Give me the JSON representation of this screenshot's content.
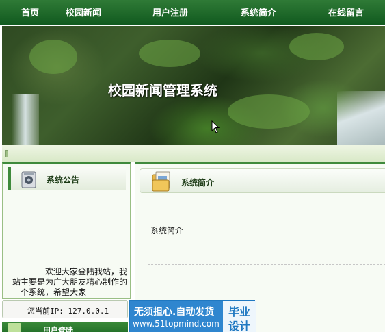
{
  "nav": {
    "items": [
      "首页",
      "校园新闻",
      "用户注册",
      "系统简介",
      "在线留言"
    ]
  },
  "banner": {
    "title": "校园新闻管理系统"
  },
  "sidebar": {
    "notice_title": "系统公告",
    "notice_text": "欢迎大家登陆我站，我站主要是为广大朋友精心制作的一个系统，希望大家"
  },
  "ip": {
    "text": "您当前IP: 127.0.0.1"
  },
  "login": {
    "title": "用户登陆"
  },
  "main": {
    "section_title": "系统简介",
    "body_text": "系统简介"
  },
  "watermark": {
    "line1": "无须担心.自动发货",
    "line2": "www.51topmind.com",
    "right1": "毕业",
    "right2": "设计"
  },
  "colors": {
    "nav_green": "#1e6a25",
    "accent_green": "#3f8a3c",
    "watermark_blue": "#2f86cf"
  }
}
